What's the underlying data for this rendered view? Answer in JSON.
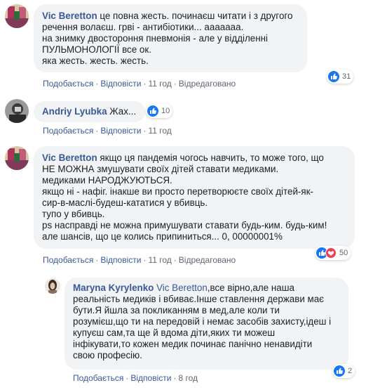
{
  "comments": [
    {
      "author": "Vic Beretton",
      "text_first": " це повна жесть. починаєш читати і з другого",
      "text_rest": "речення волаєш. грві - антибіотики... ааааааа.\nна знимку двостороння пневмонія - але у відділенні\nПУЛЬМОНОЛОГІЇ все ок.\nяка жесть. жесть. жесть.",
      "reactions": [
        "like"
      ],
      "reaction_count": "31",
      "like_label": "Подобається",
      "reply_label": "Відповісти",
      "time": "11 год",
      "edited": "Відредаговано"
    },
    {
      "author": "Andriy Lyubka",
      "text_first": " Жах...",
      "reactions": [
        "like"
      ],
      "reaction_count": "10",
      "like_label": "Подобається",
      "reply_label": "Відповісти",
      "time": "11 год"
    },
    {
      "author": "Vic Beretton",
      "text_first": " якщо ця пандемія чогось навчить, то може того, що",
      "text_rest": "НЕ МОЖНА змушувати своїх дітей ставати медиками.\nмедиками НАРОДЖУЮТЬСЯ.\nякщо ні - нафіг. інакше ви просто перетворюєте своїх дітей-як-\nсир-в-маслі-будеш-кататися у вбивць.\nтупо у вбивць.\nps насправді не можна примушувати ставати будь-ким. будь-ким!\nале шансів, що це колись припиниться... 0, 00000001%",
      "reactions": [
        "like",
        "love"
      ],
      "reaction_count": "50",
      "like_label": "Подобається",
      "reply_label": "Відповісти",
      "time": "11 год",
      "edited": "Відредаговано"
    },
    {
      "author": "Maryna Kyrylenko",
      "mention": " Vic Beretton",
      "text_first": ",все вірно,але наша",
      "text_rest": "реальність медиків і вбиває.Інше ставлення держави має\nбути.Я йшла за покликанням в мед,але коли ти\nрозумієш,що ти на передовій і немає засобів захисту,ідеш і\nкупуєш сам,та ще й вдома діти,яких ти можеш\nінфікувати,то кожен медик починає панічно ненавидіти\nсвою професію.",
      "reactions": [
        "like"
      ],
      "reaction_count": "2",
      "like_label": "Подобається",
      "reply_label": "Відповісти",
      "time": "8 год"
    }
  ],
  "colors": {
    "link": "#385898",
    "bubble": "#f2f3f5",
    "meta": "#606770",
    "like": "#1877f2",
    "love": "#f33e58"
  },
  "icons": [
    "like-icon",
    "love-icon",
    "avatar"
  ]
}
